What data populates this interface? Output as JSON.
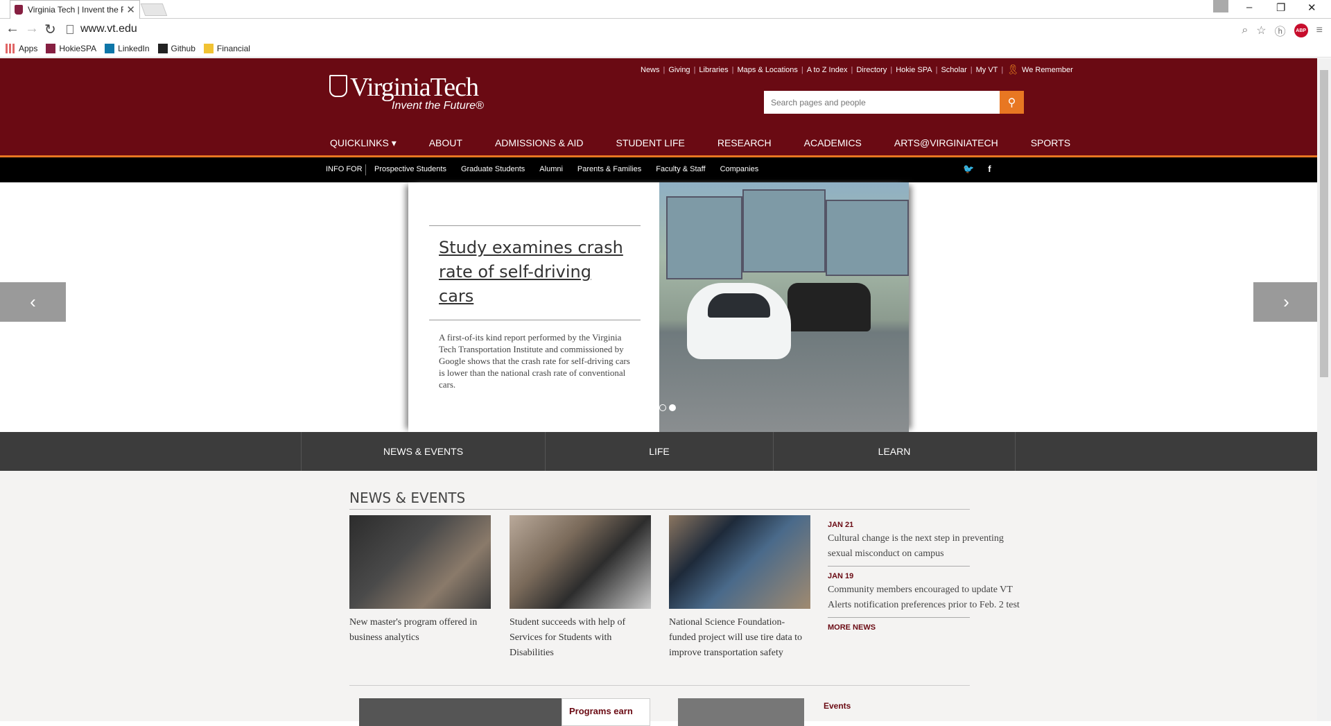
{
  "browser": {
    "tab_title": "Virginia Tech | Invent the F",
    "url": "www.vt.edu",
    "bookmarks": [
      "Apps",
      "HokieSPA",
      "LinkedIn",
      "Github",
      "Financial"
    ],
    "abp_label": "ABP"
  },
  "header": {
    "util_links": [
      "News",
      "Giving",
      "Libraries",
      "Maps & Locations",
      "A to Z Index",
      "Directory",
      "Hokie SPA",
      "Scholar",
      "My VT"
    ],
    "we_remember": "We Remember",
    "logo_word": "VirginiaTech",
    "logo_tagline": "Invent the Future®",
    "search_placeholder": "Search pages and people",
    "main_nav": [
      "QUICKLINKS ▾",
      "ABOUT",
      "ADMISSIONS & AID",
      "STUDENT LIFE",
      "RESEARCH",
      "ACADEMICS",
      "ARTS@VIRGINIATECH",
      "SPORTS"
    ],
    "info_for": "INFO FOR",
    "info_links": [
      "Prospective Students",
      "Graduate Students",
      "Alumni",
      "Parents & Families",
      "Faculty & Staff",
      "Companies"
    ],
    "social": [
      "twitter-icon",
      "facebook-icon"
    ],
    "brand_color": "#6a0a13",
    "accent_color": "#e87722"
  },
  "carousel": {
    "headline": "Study examines crash rate of self-driving cars",
    "summary": "A first-of-its kind report performed by the Virginia Tech Transportation Institute and commissioned by Google shows that the crash rate for self-driving cars is lower than the national crash rate of conventional cars.",
    "prev": "‹",
    "next": "›"
  },
  "section_tabs": [
    "NEWS & EVENTS",
    "LIFE",
    "LEARN"
  ],
  "news": {
    "title": "NEWS & EVENTS",
    "stories": [
      "New master's program offered in business analytics",
      "Student succeeds with help of Services for Students with Disabilities",
      "National Science Foundation-funded project will use tire data to improve transportation safety"
    ],
    "side": [
      {
        "date": "JAN 21",
        "text": "Cultural change is the next step in preventing sexual misconduct on campus"
      },
      {
        "date": "JAN 19",
        "text": "Community members encouraged to update VT Alerts notification preferences prior to Feb. 2 test"
      }
    ],
    "more_news": "MORE NEWS",
    "feature_label": "Programs earn",
    "events_label": "Events"
  }
}
